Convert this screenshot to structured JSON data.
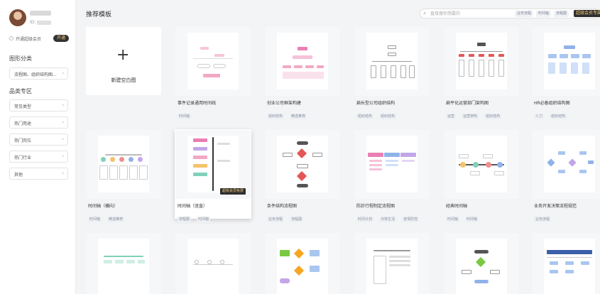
{
  "sidebar": {
    "user_id_label": "ID:",
    "vip_text": "开通超级会员",
    "vip_button": "开通",
    "category_title": "图形分类",
    "category_items": [
      {
        "label": "流程图、组织结构图..."
      }
    ],
    "special_title": "品类专区",
    "special_items": [
      {
        "label": "常见类型"
      },
      {
        "label": "热门用途"
      },
      {
        "label": "热门岗位"
      },
      {
        "label": "热门行业"
      },
      {
        "label": "其他"
      }
    ]
  },
  "header": {
    "title": "推荐模板",
    "search_placeholder": "直接搜你想要的",
    "search_tags": [
      "业务流程",
      "时间轴",
      "流程图"
    ],
    "vip_zone": "超级会员专属"
  },
  "new_card": {
    "label": "新建空白图"
  },
  "cards": [
    {
      "title": "事件记录通用时间线",
      "tags": [
        "时间轴"
      ]
    },
    {
      "title": "创业公司框架构建",
      "tags": [
        "组织结构",
        "精选推荐"
      ]
    },
    {
      "title": "扁长型公司组织结构",
      "tags": [
        "组织结构",
        "组织结构"
      ]
    },
    {
      "title": "扁平化运营部门架构图",
      "tags": [
        "运营",
        "运营架构",
        "组织结构"
      ]
    },
    {
      "title": "HR必备组织结构图",
      "tags": [
        "人力",
        "组织结构"
      ]
    },
    {
      "title": "时间轴（横向）",
      "tags": [
        "时间轴",
        "精选推荐"
      ]
    },
    {
      "title": "时间轴（竖直）",
      "tags": [
        "流程图",
        "时间轴"
      ],
      "badge": "超级会员免费"
    },
    {
      "title": "条件结构流程图",
      "tags": [
        "业务流程",
        "流程图"
      ]
    },
    {
      "title": "防診行程制定流程图",
      "tags": [
        "时间计划",
        "日常生活",
        "疫情防控"
      ]
    },
    {
      "title": "经典时间轴",
      "tags": [
        "时间轴",
        "时间轴"
      ]
    },
    {
      "title": "业务开发决策流程规范",
      "tags": [
        "业务流程"
      ]
    }
  ]
}
